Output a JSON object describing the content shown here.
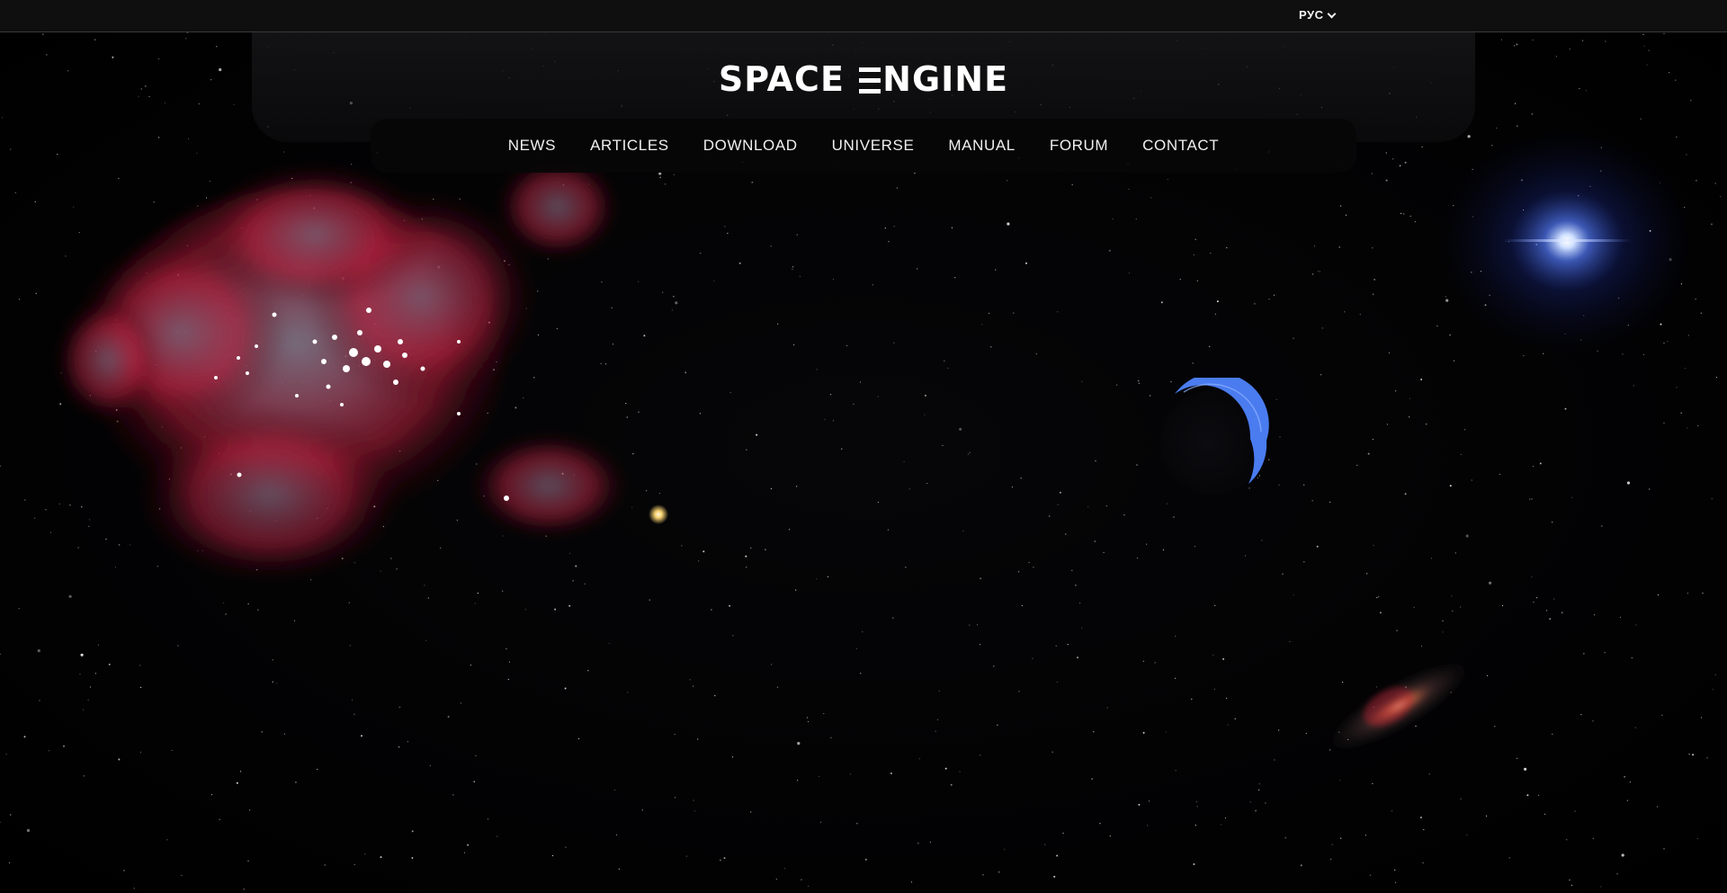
{
  "topbar": {
    "language_label": "РУС"
  },
  "header": {
    "logo_text_left": "SPACE",
    "logo_text_right": "NGINE"
  },
  "nav": {
    "items": [
      {
        "label": "NEWS"
      },
      {
        "label": "ARTICLES"
      },
      {
        "label": "DOWNLOAD"
      },
      {
        "label": "UNIVERSE"
      },
      {
        "label": "MANUAL"
      },
      {
        "label": "FORUM"
      },
      {
        "label": "CONTACT"
      }
    ]
  },
  "colors": {
    "background": "#020203",
    "topbar": "#0f0f10",
    "text": "#f0f0f0",
    "nebula": "#b8243a",
    "blue_star": "#5a8cff",
    "planet_rim": "#4a7cf0"
  },
  "icons": {
    "language_dropdown": "chevron-down-icon"
  }
}
